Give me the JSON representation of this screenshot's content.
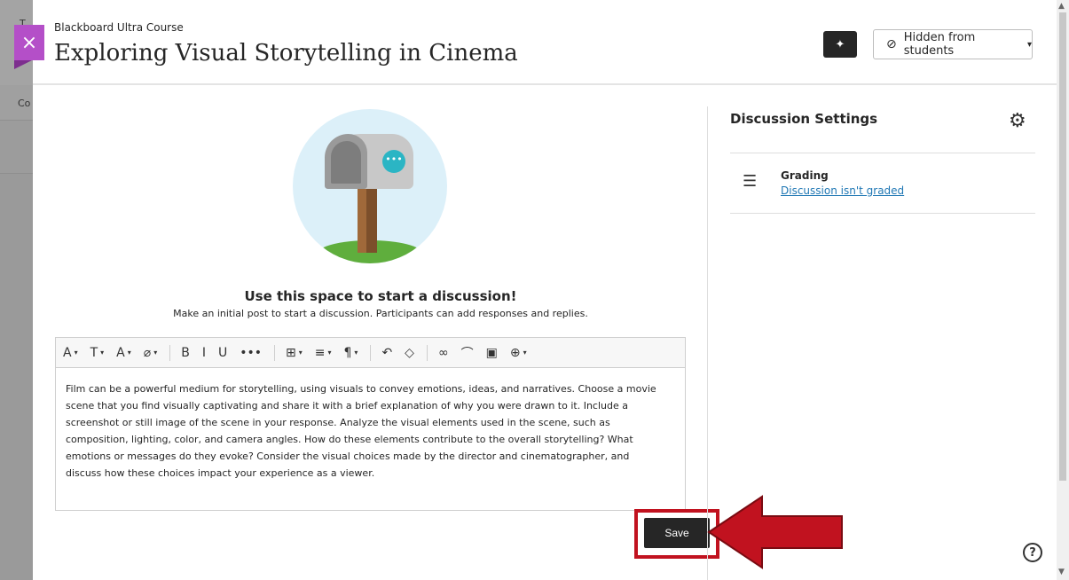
{
  "background": {
    "letter_top": "T",
    "letter_mid": "Co"
  },
  "header": {
    "course_name": "Blackboard Ultra Course",
    "title": "Exploring Visual Storytelling in Cinema",
    "visibility_label": "Hidden from students",
    "close_glyph": "×",
    "ai_glyph": "✦",
    "visibility_glyph": "⊘",
    "caret_glyph": "▾"
  },
  "main": {
    "prompt_title": "Use this space to start a discussion!",
    "prompt_subtitle": "Make an initial post to start a discussion. Participants can add responses and replies.",
    "bubble_glyph": "•••",
    "toolbar": [
      {
        "name": "text-style-icon",
        "glyph": "A",
        "caret": "▾"
      },
      {
        "name": "paragraph-style-icon",
        "glyph": "T",
        "caret": "▾"
      },
      {
        "name": "font-size-icon",
        "glyph": "A",
        "caret": "▾"
      },
      {
        "name": "highlight-icon",
        "glyph": "⌀",
        "caret": "▾"
      },
      {
        "name": "bold-icon",
        "glyph": "B",
        "caret": ""
      },
      {
        "name": "italic-icon",
        "glyph": "I",
        "caret": ""
      },
      {
        "name": "underline-icon",
        "glyph": "U",
        "caret": ""
      },
      {
        "name": "more-icon",
        "glyph": "•••",
        "caret": ""
      },
      {
        "name": "table-icon",
        "glyph": "⊞",
        "caret": "▾"
      },
      {
        "name": "align-icon",
        "glyph": "≡",
        "caret": "▾"
      },
      {
        "name": "paragraph-icon",
        "glyph": "¶",
        "caret": "▾"
      },
      {
        "name": "undo-icon",
        "glyph": "↶",
        "caret": ""
      },
      {
        "name": "eraser-icon",
        "glyph": "◇",
        "caret": ""
      },
      {
        "name": "link-icon",
        "glyph": "∞",
        "caret": ""
      },
      {
        "name": "attach-icon",
        "glyph": "⌒",
        "caret": ""
      },
      {
        "name": "image-icon",
        "glyph": "▣",
        "caret": ""
      },
      {
        "name": "insert-icon",
        "glyph": "⊕",
        "caret": "▾"
      }
    ],
    "body_text": "Film can be a powerful medium for storytelling, using visuals to convey emotions, ideas, and narratives. Choose a movie scene that you find visually captivating and share it with a brief explanation of why you were drawn to it. Include a screenshot or still image of the scene in your response. Analyze the visual elements used in the scene, such as composition, lighting, color, and camera angles. How do these elements contribute to the overall storytelling? What emotions or messages do they evoke? Consider the visual choices made by the director and cinematographer, and discuss how these choices impact your experience as a viewer.",
    "save_label": "Save"
  },
  "sidebar": {
    "title": "Discussion Settings",
    "gear_glyph": "⚙",
    "grading_glyph": "☰",
    "grading_label": "Grading",
    "grading_value": "Discussion isn't graded"
  },
  "help_glyph": "?",
  "colors": {
    "accent": "#b44fc8",
    "highlight": "#c1121f",
    "link": "#1f77b4"
  }
}
